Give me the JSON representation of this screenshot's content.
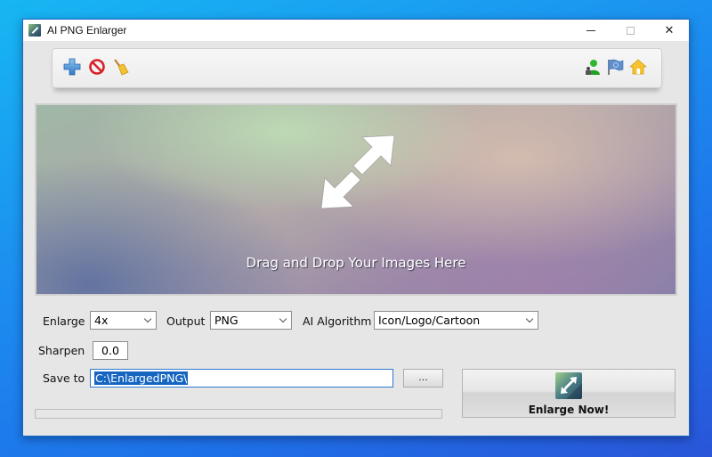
{
  "window": {
    "title": "AI PNG Enlarger",
    "controls": {
      "minimize": "minimize",
      "maximize": "maximize",
      "close": "✕"
    }
  },
  "toolbar": {
    "left_icons": [
      "add-icon",
      "remove-icon",
      "clear-icon"
    ],
    "right_icons": [
      "user-icon",
      "flag-icon",
      "home-icon"
    ]
  },
  "dropzone": {
    "text": "Drag and Drop Your Images Here",
    "icon": "resize-arrow-icon"
  },
  "settings": {
    "enlarge": {
      "label": "Enlarge",
      "value": "4x"
    },
    "output": {
      "label": "Output",
      "value": "PNG"
    },
    "algorithm": {
      "label": "AI Algorithm",
      "value": "Icon/Logo/Cartoon"
    },
    "sharpen": {
      "label": "Sharpen",
      "value": "0.0"
    },
    "save_to": {
      "label": "Save to",
      "value": "C:\\EnlargedPNG\\"
    },
    "browse_label": "..."
  },
  "progress": {
    "percent": 0
  },
  "action": {
    "label": "Enlarge Now!"
  }
}
